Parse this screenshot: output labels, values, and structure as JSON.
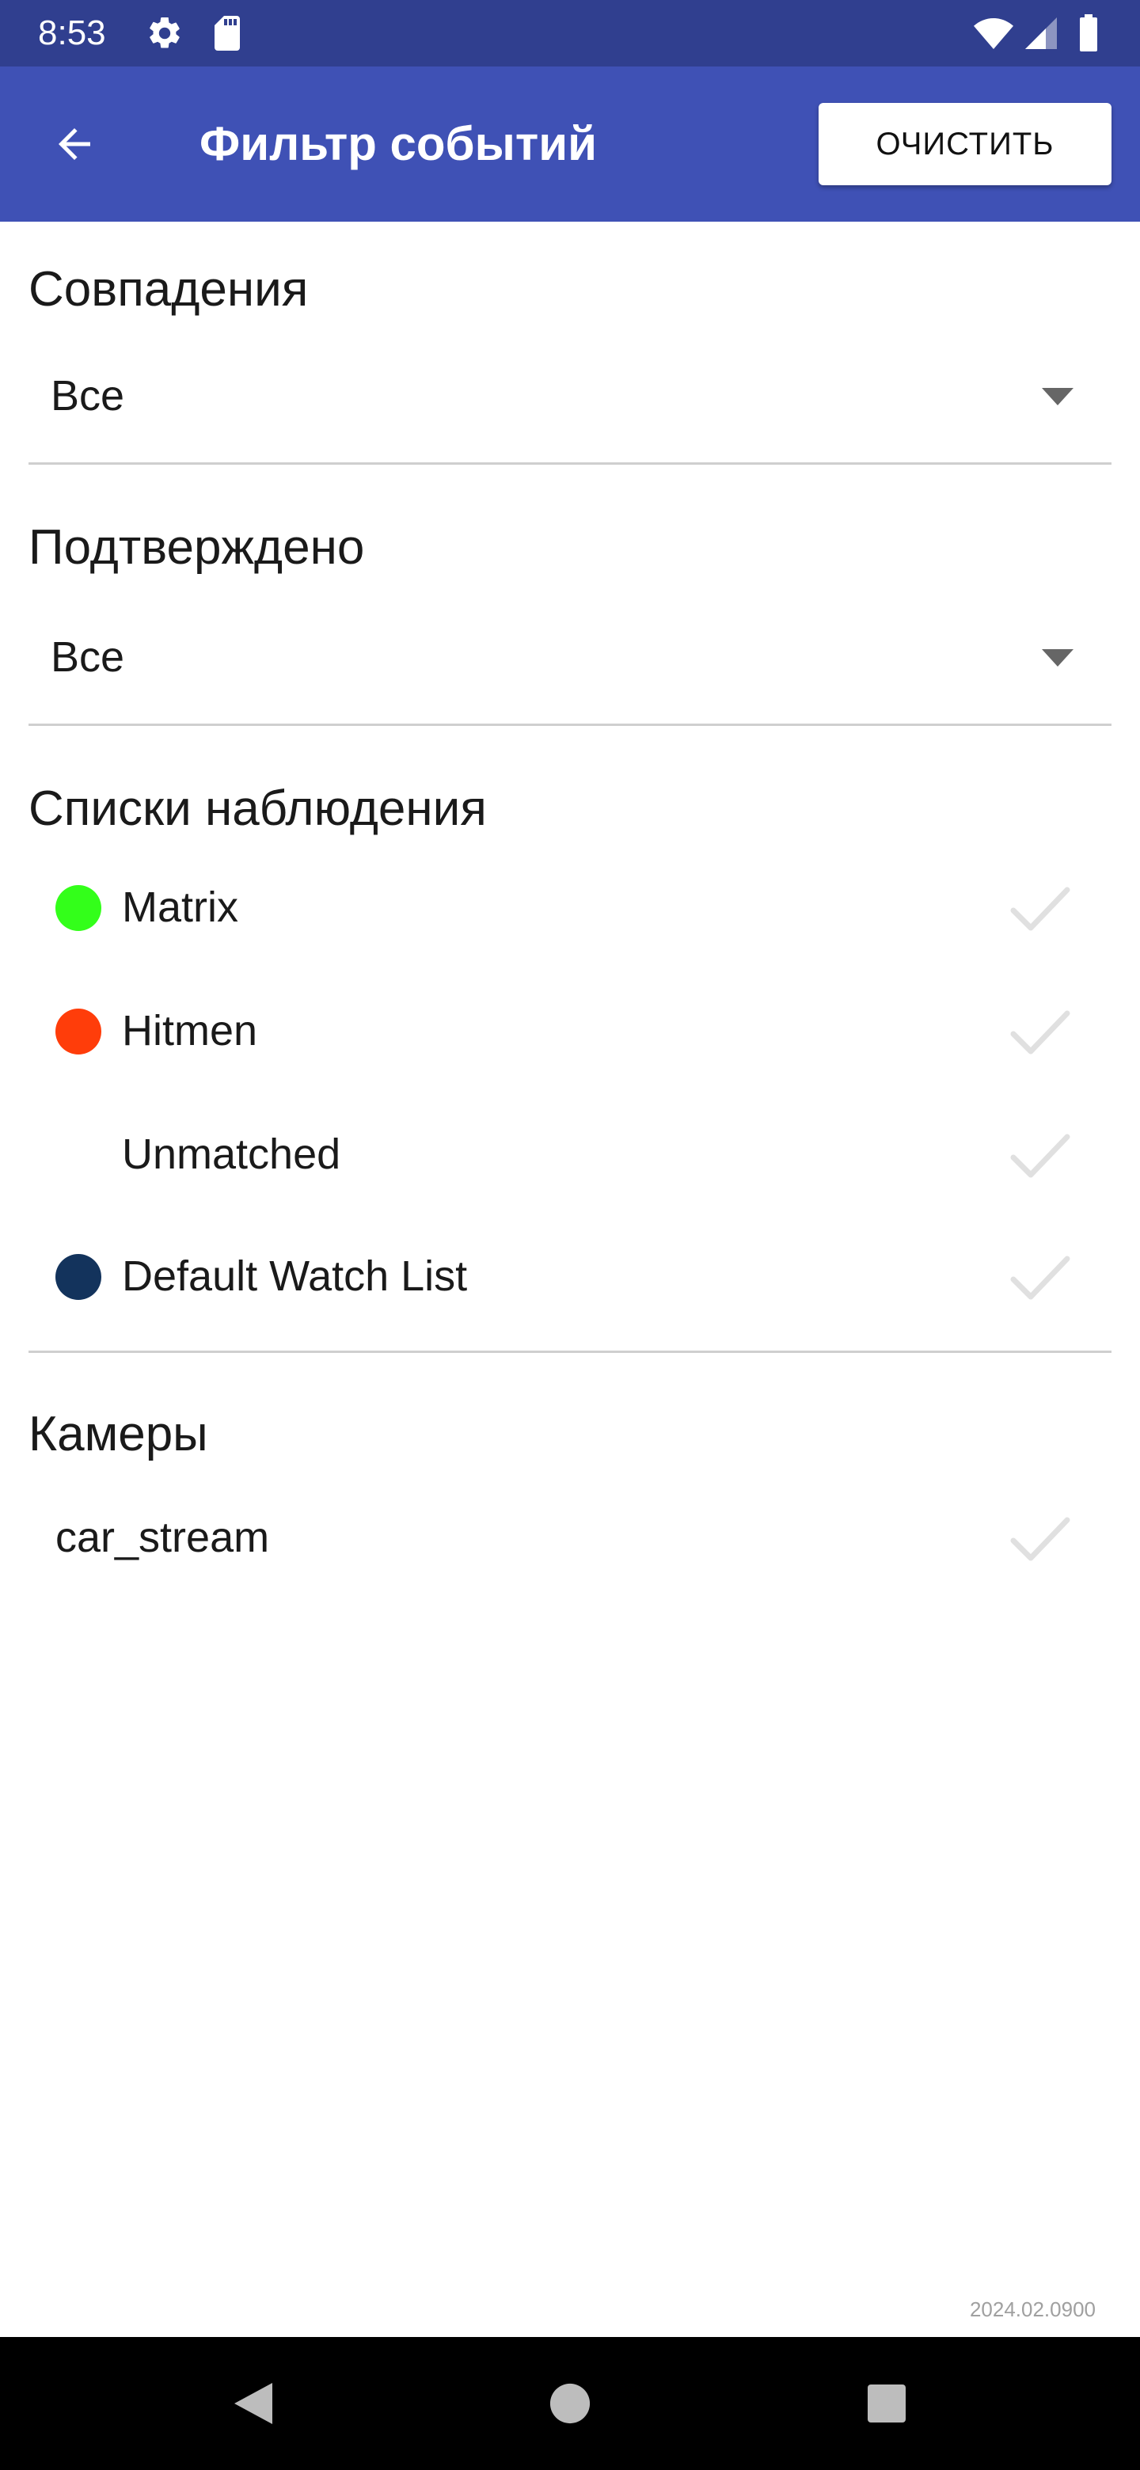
{
  "status_bar": {
    "time": "8:53",
    "icons": [
      "gear-icon",
      "sd-card-icon",
      "wifi-icon",
      "signal-icon",
      "battery-icon"
    ]
  },
  "app_bar": {
    "title": "Фильтр событий",
    "clear_label": "ОЧИСТИТЬ",
    "background_color": "#3f51b5"
  },
  "matches": {
    "title": "Совпадения",
    "selected": "Все"
  },
  "confirmed": {
    "title": "Подтверждено",
    "selected": "Все"
  },
  "watch_lists": {
    "title": "Списки наблюдения",
    "items": [
      {
        "label": "Matrix",
        "color": "#33ff1a",
        "checked": false
      },
      {
        "label": "Hitmen",
        "color": "#ff3d0a",
        "checked": false
      },
      {
        "label": "Unmatched",
        "color": "",
        "checked": false
      },
      {
        "label": "Default Watch List",
        "color": "#13335c",
        "checked": false
      }
    ]
  },
  "cameras": {
    "title": "Камеры",
    "items": [
      {
        "label": "car_stream",
        "checked": false
      }
    ]
  },
  "version": "2024.02.0900",
  "nav_bar": {
    "buttons": [
      "back-triangle-icon",
      "home-circle-icon",
      "recents-square-icon"
    ]
  }
}
